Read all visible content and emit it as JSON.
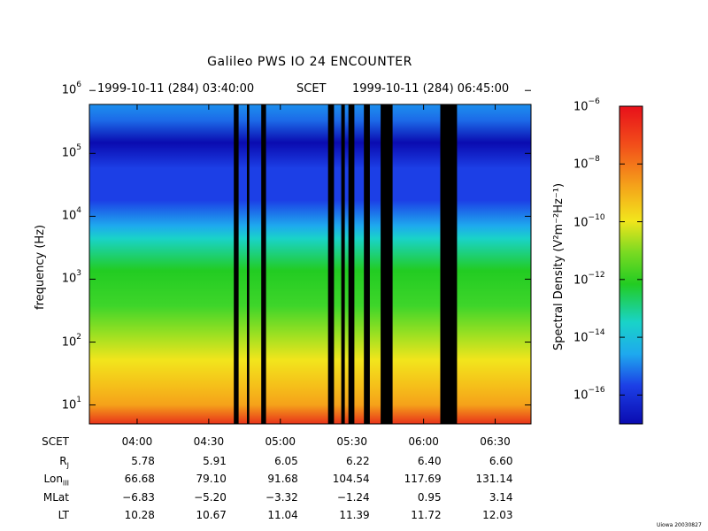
{
  "header": {
    "title": "Galileo PWS IO 24 ENCOUNTER",
    "scet_start": "1999-10-11 (284) 03:40:00",
    "scet_label": "SCET",
    "scet_end": "1999-10-11 (284) 06:45:00"
  },
  "chart_data": {
    "type": "heatmap",
    "title": "Galileo PWS IO 24 ENCOUNTER",
    "ylabel": "frequency (Hz)",
    "yscale": "log",
    "ylim": [
      5,
      600000
    ],
    "yticks": [
      {
        "base": "10",
        "exp": "1"
      },
      {
        "base": "10",
        "exp": "2"
      },
      {
        "base": "10",
        "exp": "3"
      },
      {
        "base": "10",
        "exp": "4"
      },
      {
        "base": "10",
        "exp": "5"
      },
      {
        "base": "10",
        "exp": "6"
      }
    ],
    "xlim": [
      "03:40:00",
      "06:45:00"
    ],
    "xticks": [
      "04:00",
      "04:30",
      "05:00",
      "05:30",
      "06:00",
      "06:30"
    ],
    "colorbar": {
      "label": "Spectral Density (V²m⁻²Hz⁻¹)",
      "scale": "log",
      "range": [
        1e-17,
        1e-06
      ],
      "ticks": [
        {
          "base": "10",
          "exp": "−6"
        },
        {
          "base": "10",
          "exp": "−8"
        },
        {
          "base": "10",
          "exp": "−10"
        },
        {
          "base": "10",
          "exp": "−12"
        },
        {
          "base": "10",
          "exp": "−14"
        },
        {
          "base": "10",
          "exp": "−16"
        }
      ]
    },
    "data_gaps": [
      [
        "04:40:30",
        "04:42:30"
      ],
      [
        "04:46:00",
        "04:47:00"
      ],
      [
        "04:52:00",
        "04:54:00"
      ],
      [
        "05:20:00",
        "05:22:30"
      ],
      [
        "05:25:30",
        "05:27:00"
      ],
      [
        "05:28:30",
        "05:31:00"
      ],
      [
        "05:35:00",
        "05:37:30"
      ],
      [
        "05:42:00",
        "05:47:00"
      ],
      [
        "06:07:00",
        "06:14:00"
      ]
    ],
    "colors": {
      "red": "#e8331a",
      "orange": "#f5a21a",
      "yellow": "#f2e51c",
      "green": "#22cc22",
      "cyan": "#19d3c8",
      "lightblue": "#1ea9ee",
      "blue": "#1c3fe6",
      "darkblue": "#0a0bb0",
      "gap": "#000000"
    }
  },
  "ephemeris": {
    "rows": [
      {
        "label": "SCET",
        "sub": "",
        "values": [
          "04:00",
          "04:30",
          "05:00",
          "05:30",
          "06:00",
          "06:30"
        ]
      },
      {
        "label": "R",
        "sub": "J",
        "values": [
          "5.78",
          "5.91",
          "6.05",
          "6.22",
          "6.40",
          "6.60"
        ]
      },
      {
        "label": "Lon",
        "sub": "III",
        "values": [
          "66.68",
          "79.10",
          "91.68",
          "104.54",
          "117.69",
          "131.14"
        ]
      },
      {
        "label": "MLat",
        "sub": "",
        "values": [
          "−6.83",
          "−5.20",
          "−3.32",
          "−1.24",
          "0.95",
          "3.14"
        ]
      },
      {
        "label": "LT",
        "sub": "",
        "values": [
          "10.28",
          "10.67",
          "11.04",
          "11.39",
          "11.72",
          "12.03"
        ]
      }
    ]
  },
  "credit": "Uiowa 20030827"
}
